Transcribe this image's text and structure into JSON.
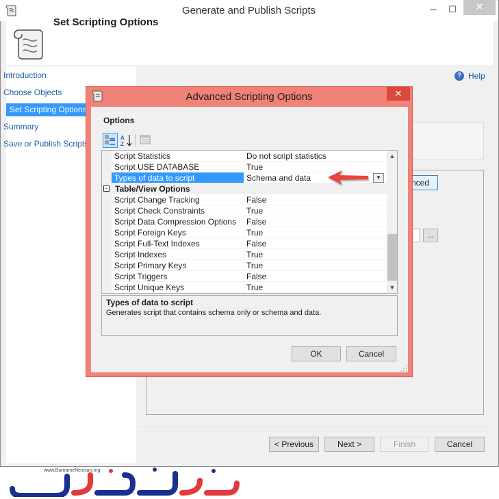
{
  "main_window": {
    "title": "Generate and Publish Scripts",
    "header_title": "Set Scripting Options",
    "close_glyph": "✕",
    "minimize_glyph": "─",
    "maximize_glyph": "☐"
  },
  "nav": {
    "items": [
      {
        "label": "Introduction",
        "selected": false
      },
      {
        "label": "Choose Objects",
        "selected": false
      },
      {
        "label": "Set Scripting Options",
        "selected": true
      },
      {
        "label": "Summary",
        "selected": false
      },
      {
        "label": "Save or Publish Scripts",
        "selected": false
      }
    ]
  },
  "help": {
    "label": "Help",
    "icon": "?"
  },
  "background": {
    "advanced_button_fragment": "nced",
    "browse_label": "..."
  },
  "footer": {
    "previous": "< Previous",
    "next": "Next >",
    "finish": "Finish",
    "cancel": "Cancel"
  },
  "dialog": {
    "title": "Advanced Scripting Options",
    "close_glyph": "✕",
    "options_label": "Options",
    "grid": {
      "rows": [
        {
          "kind": "prop",
          "name": "Script Statistics",
          "value": "Do not script statistics"
        },
        {
          "kind": "prop",
          "name": "Script USE DATABASE",
          "value": "True"
        },
        {
          "kind": "prop",
          "name": "Types of data to script",
          "value": "Schema and data",
          "selected": true
        },
        {
          "kind": "category",
          "name": "Table/View Options",
          "toggle": "−"
        },
        {
          "kind": "prop",
          "name": "Script Change Tracking",
          "value": "False"
        },
        {
          "kind": "prop",
          "name": "Script Check Constraints",
          "value": "True"
        },
        {
          "kind": "prop",
          "name": "Script Data Compression Options",
          "value": "False"
        },
        {
          "kind": "prop",
          "name": "Script Foreign Keys",
          "value": "True"
        },
        {
          "kind": "prop",
          "name": "Script Full-Text Indexes",
          "value": "False"
        },
        {
          "kind": "prop",
          "name": "Script Indexes",
          "value": "True"
        },
        {
          "kind": "prop",
          "name": "Script Primary Keys",
          "value": "True"
        },
        {
          "kind": "prop",
          "name": "Script Triggers",
          "value": "False"
        },
        {
          "kind": "prop",
          "name": "Script Unique Keys",
          "value": "True"
        }
      ]
    },
    "description": {
      "title": "Types of data to script",
      "text": "Generates script that contains schema only or schema and data."
    },
    "ok": "OK",
    "cancel": "Cancel"
  },
  "colors": {
    "dialog_border": "#f08277",
    "selection": "#3399ff",
    "arrow": "#e8453c",
    "link": "#1f5ca9"
  },
  "logo": {
    "url_text": "www.BarnameNevisan.org"
  }
}
